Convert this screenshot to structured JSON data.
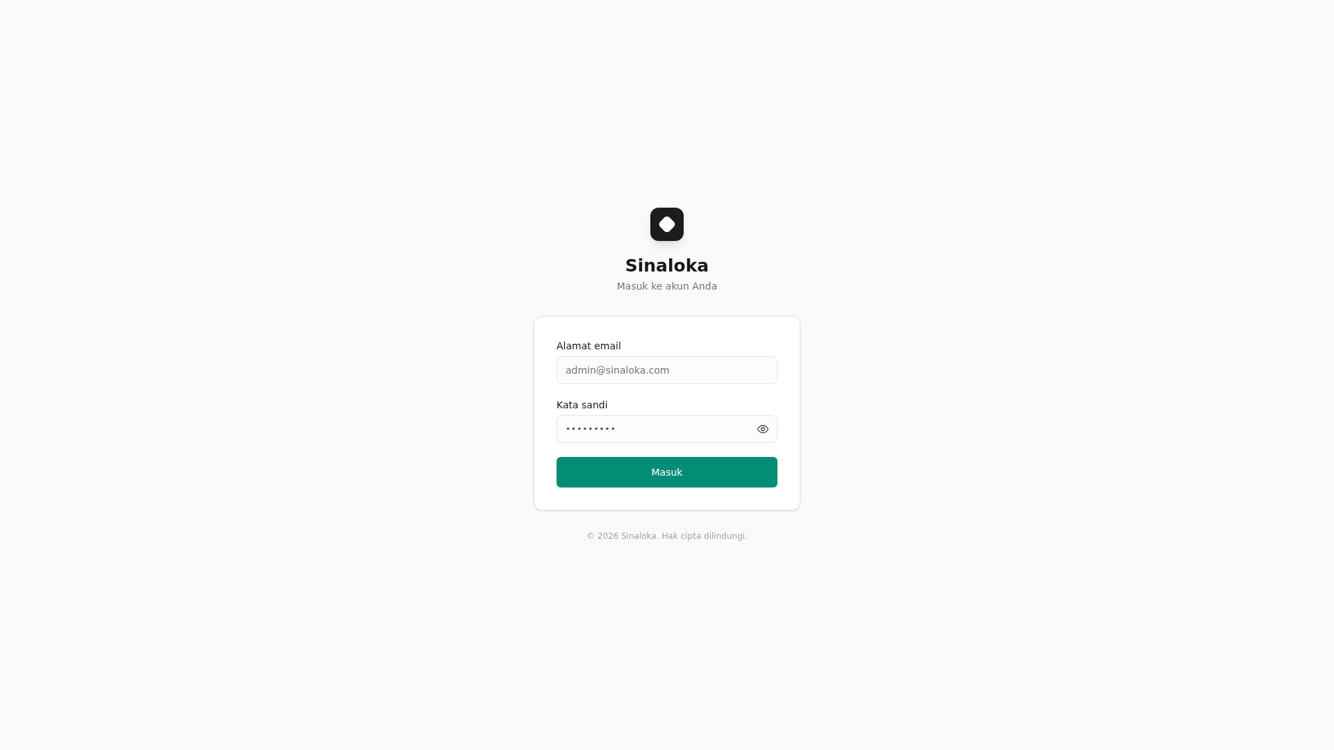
{
  "brand": {
    "title": "Sinaloka",
    "subtitle": "Masuk ke akun Anda"
  },
  "form": {
    "email": {
      "label": "Alamat email",
      "placeholder": "admin@sinaloka.com"
    },
    "password": {
      "label": "Kata sandi",
      "value": "•••••••••"
    },
    "submit": "Masuk"
  },
  "footer": "© 2026 Sinaloka. Hak cipta dilindungi."
}
